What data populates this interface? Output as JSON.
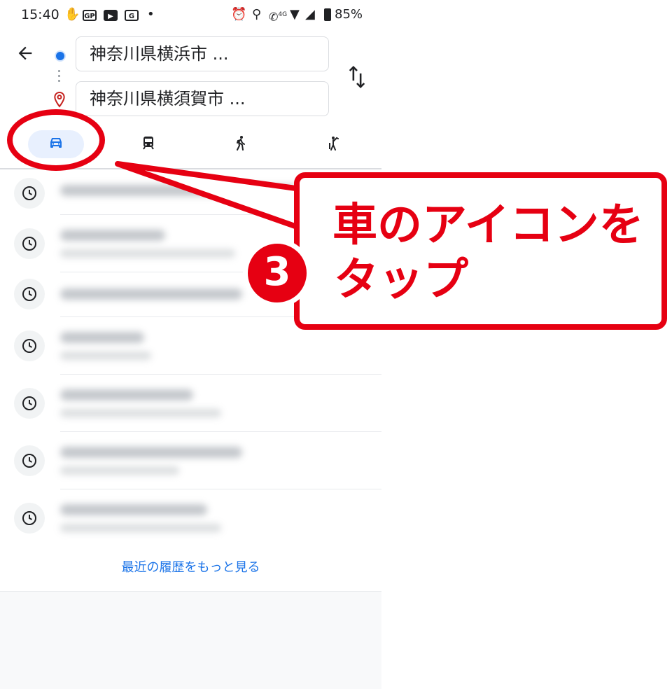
{
  "status_bar": {
    "time": "15:40",
    "battery": "85%",
    "network": "4G",
    "icons": [
      "hand-icon",
      "gp-app-icon",
      "youtube-icon",
      "gmail-icon",
      "dot-icon",
      "alarm-icon",
      "location-icon",
      "wifi-call-icon",
      "wifi-icon",
      "signal-icon",
      "battery-icon"
    ]
  },
  "directions": {
    "origin": "神奈川県横浜市 ...",
    "destination": "神奈川県横須賀市 ..."
  },
  "travel_modes": [
    {
      "name": "drive",
      "icon": "car-icon",
      "selected": true
    },
    {
      "name": "transit",
      "icon": "train-icon",
      "selected": false
    },
    {
      "name": "walk",
      "icon": "walk-icon",
      "selected": false
    },
    {
      "name": "ride",
      "icon": "ride-icon",
      "selected": false
    }
  ],
  "history_more_link": "最近の履歴をもっと見る",
  "annotation": {
    "step_number": "3",
    "line1": "車のアイコンを",
    "line2": "タップ",
    "color": "#e60012"
  },
  "colors": {
    "accent": "#1a73e8",
    "selected_mode_bg": "#e8f0fe",
    "annotation_red": "#e60012"
  }
}
